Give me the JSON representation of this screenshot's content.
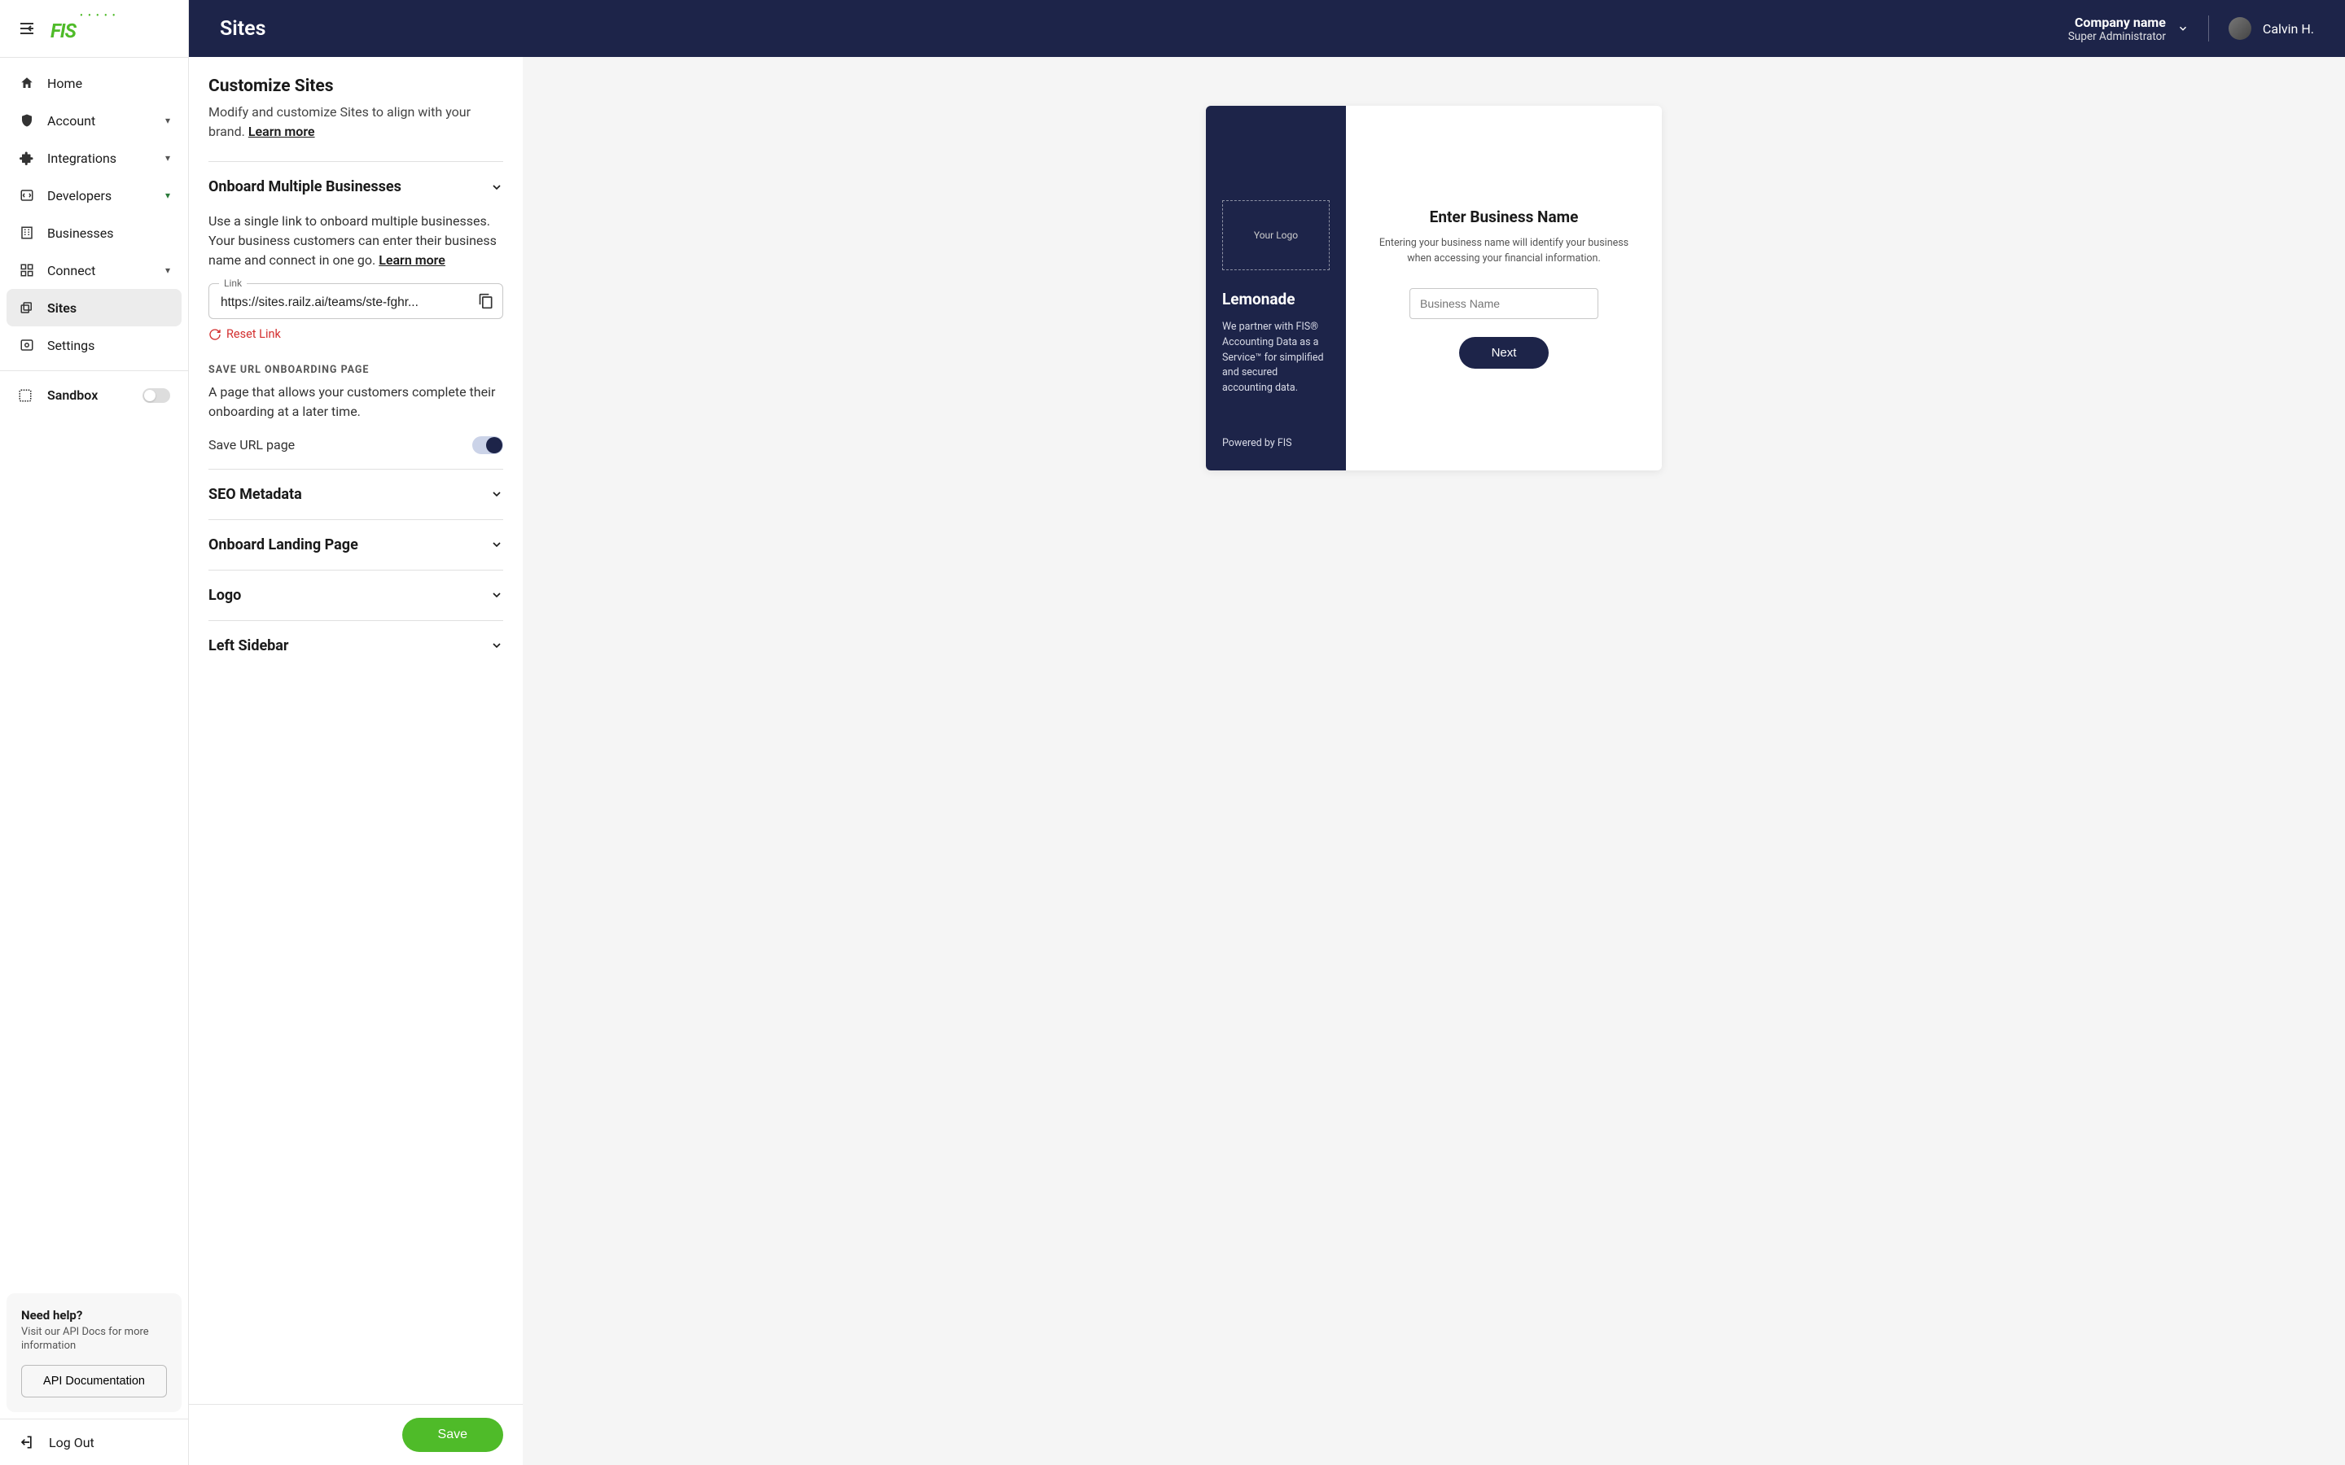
{
  "header": {
    "title": "Sites",
    "company": "Company name",
    "role": "Super Administrator",
    "user": "Calvin H."
  },
  "sidebar": {
    "items": [
      {
        "label": "Home",
        "icon": "home"
      },
      {
        "label": "Account",
        "icon": "shield",
        "expandable": true
      },
      {
        "label": "Integrations",
        "icon": "puzzle",
        "expandable": true
      },
      {
        "label": "Developers",
        "icon": "code",
        "expandable": true,
        "open": true
      },
      {
        "label": "Businesses",
        "icon": "building"
      },
      {
        "label": "Connect",
        "icon": "grid",
        "expandable": true
      },
      {
        "label": "Sites",
        "icon": "layers",
        "active": true
      },
      {
        "label": "Settings",
        "icon": "settings-page"
      }
    ],
    "sandbox_label": "Sandbox",
    "help": {
      "title": "Need help?",
      "text": "Visit our API Docs for more information",
      "button": "API Documentation"
    },
    "logout": "Log Out"
  },
  "customize": {
    "title": "Customize Sites",
    "desc_prefix": "Modify and customize Sites to align with your brand. ",
    "learn_more": "Learn more"
  },
  "onboard": {
    "title": "Onboard Multiple Businesses",
    "desc_prefix": "Use a single link to onboard multiple businesses. Your business customers can enter their business name and connect in one go. ",
    "learn_more": "Learn more",
    "link_label": "Link",
    "link_value": "https://sites.railz.ai/teams/ste-fghr...",
    "reset": "Reset Link"
  },
  "save_url": {
    "subhead": "SAVE URL ONBOARDING PAGE",
    "desc": "A page that allows your customers complete their onboarding at a later time.",
    "toggle_label": "Save URL page"
  },
  "sections": {
    "seo": "SEO Metadata",
    "landing": "Onboard Landing Page",
    "logo": "Logo",
    "left_sidebar": "Left Sidebar"
  },
  "save_button": "Save",
  "preview": {
    "logo_placeholder": "Your Logo",
    "brand": "Lemonade",
    "brand_desc": "We partner with FIS® Accounting Data as a Service™ for simplified and secured accounting data.",
    "powered": "Powered by FIS",
    "right_title": "Enter Business Name",
    "right_desc": "Entering your business name will identify your business when accessing your financial information.",
    "input_placeholder": "Business Name",
    "next": "Next"
  }
}
